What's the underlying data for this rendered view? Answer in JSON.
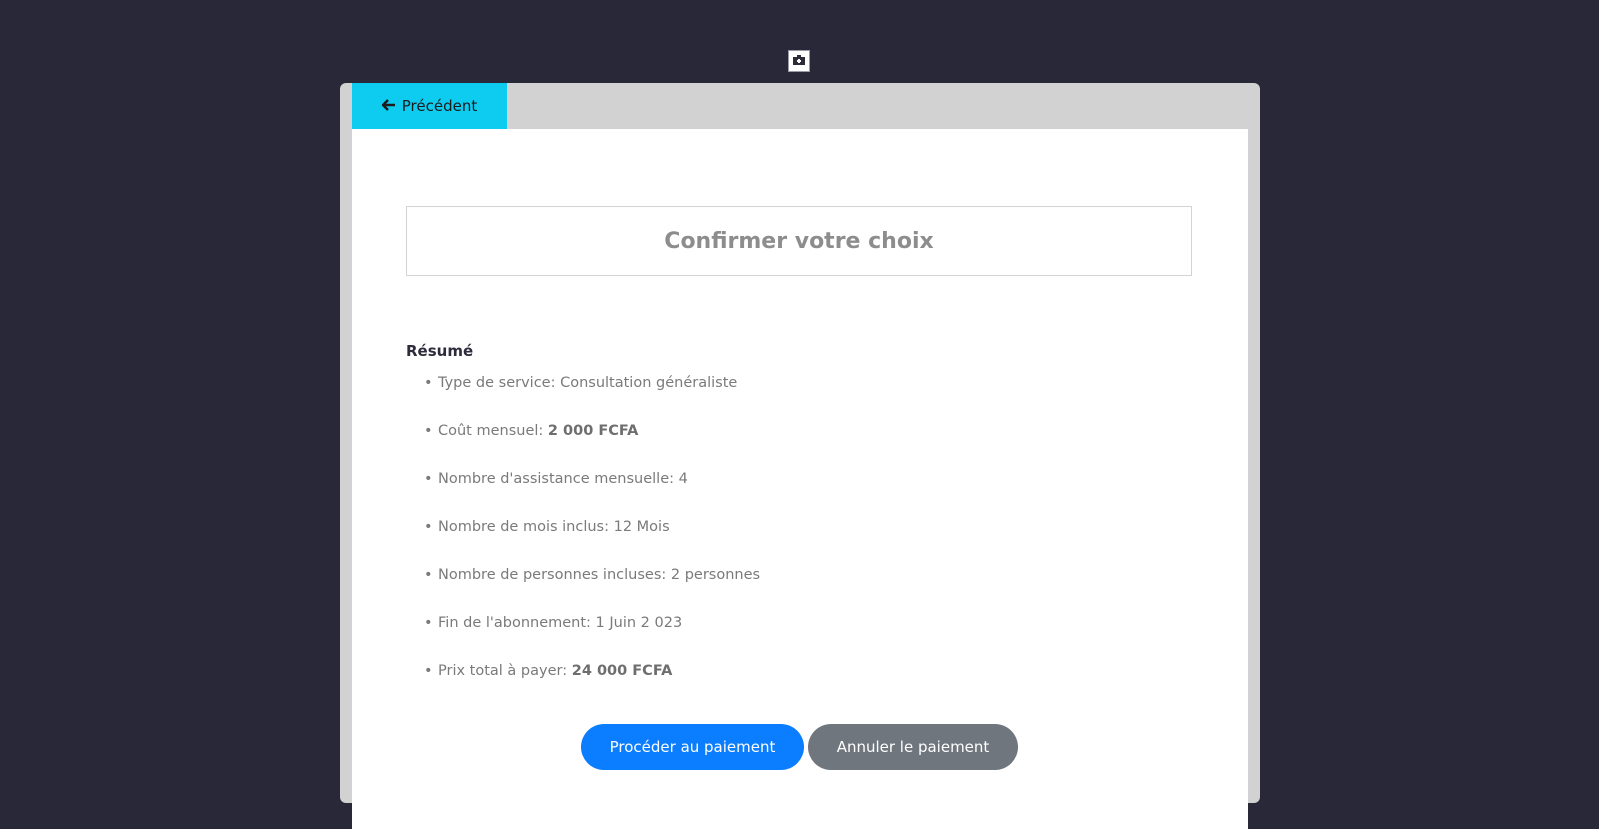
{
  "header": {
    "logo_icon": "clinic-logo-icon"
  },
  "nav": {
    "back_label": "Précédent",
    "back_icon": "arrow-left-icon"
  },
  "main": {
    "title": "Confirmer votre choix",
    "summary_heading": "Résumé",
    "items": [
      {
        "label": "Type de service: ",
        "value": "Consultation généraliste",
        "bold": false
      },
      {
        "label": "Coût mensuel: ",
        "value": "2 000 FCFA",
        "bold": true
      },
      {
        "label": "Nombre d'assistance mensuelle: ",
        "value": "4",
        "bold": false
      },
      {
        "label": "Nombre de mois inclus: ",
        "value": "12 Mois",
        "bold": false
      },
      {
        "label": "Nombre de personnes incluses: ",
        "value": "2 personnes",
        "bold": false
      },
      {
        "label": "Fin de l'abonnement: ",
        "value": "1 Juin 2 023",
        "bold": false
      },
      {
        "label": "Prix total à payer: ",
        "value": "24 000 FCFA",
        "bold": true
      }
    ]
  },
  "actions": {
    "proceed_label": "Procéder au paiement",
    "cancel_label": "Annuler le paiement"
  },
  "colors": {
    "background": "#292838",
    "back_button": "#0ecbf0",
    "primary_button": "#0b7dff",
    "secondary_button": "#6f767e"
  }
}
